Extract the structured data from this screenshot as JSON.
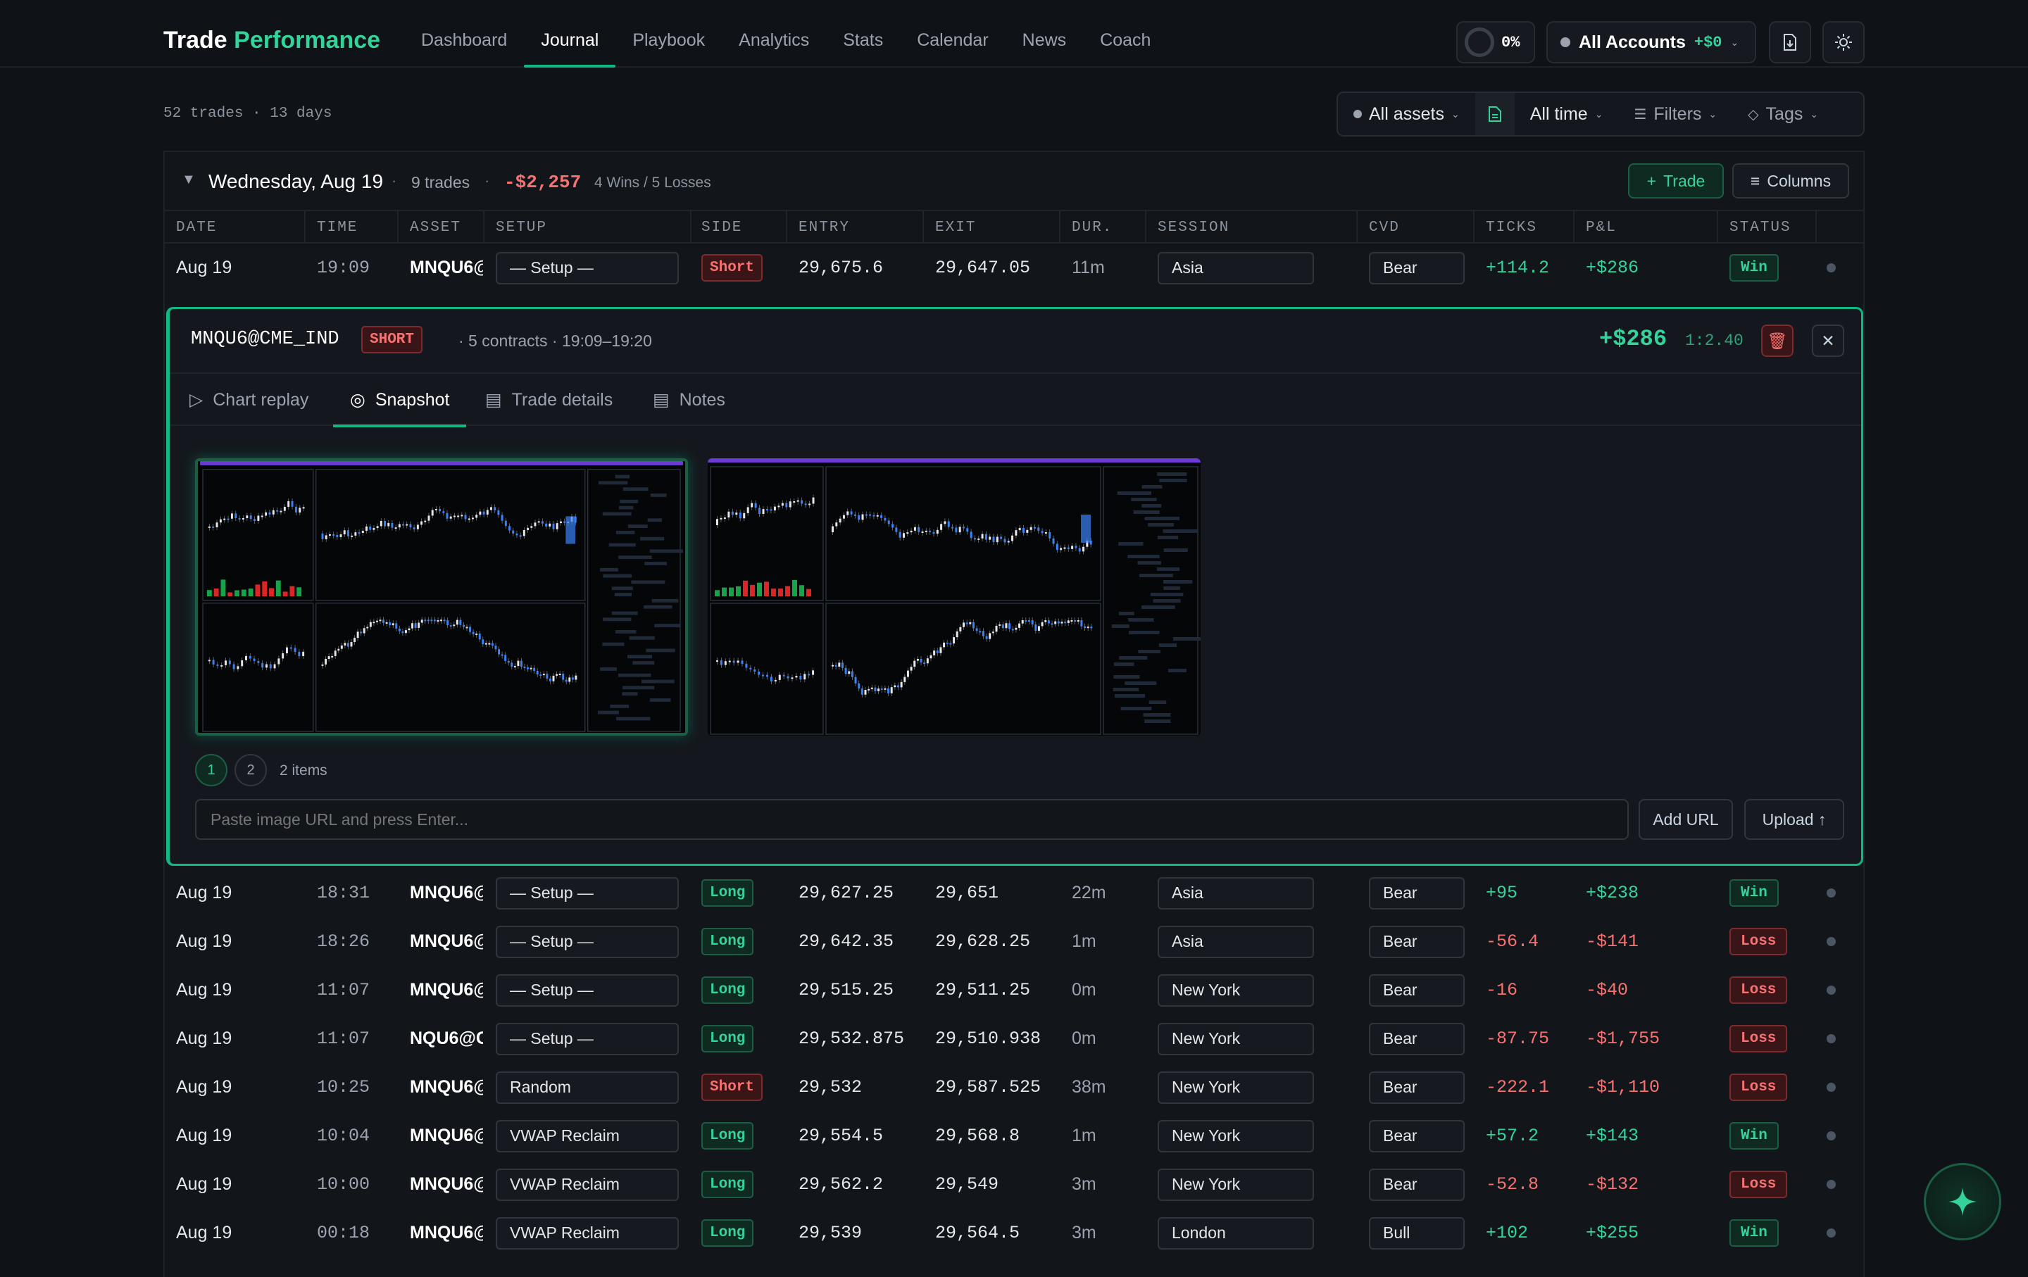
{
  "brand": {
    "title_a": "Trade",
    "title_b": "Performance"
  },
  "nav": [
    "Dashboard",
    "Journal",
    "Playbook",
    "Analytics",
    "Stats",
    "Calendar",
    "News",
    "Coach"
  ],
  "header": {
    "progress": "0%",
    "accounts_label": "All Accounts",
    "accounts_value": "+$0"
  },
  "meta": {
    "count": "52 trades · 13 days"
  },
  "filters": {
    "assets": "All assets",
    "time": "All time",
    "filters": "Filters",
    "tags": "Tags"
  },
  "day": {
    "title": "Wednesday, Aug 19",
    "trades": "9 trades",
    "pnl": "-$2,257",
    "record": "4 Wins / 5 Losses",
    "add_trade": "Trade",
    "columns": "Columns"
  },
  "columns": [
    "DATE",
    "TIME",
    "ASSET",
    "SETUP",
    "SIDE",
    "ENTRY",
    "EXIT",
    "DUR.",
    "SESSION",
    "CVD",
    "TICKS",
    "P&L",
    "STATUS"
  ],
  "panel": {
    "symbol": "MNQU6@CME_IND",
    "side": "SHORT",
    "summary": "· 5 contracts · 19:09–19:20",
    "pnl": "+$286",
    "rr": "1:2.40",
    "tabs": [
      "Chart replay",
      "Snapshot",
      "Trade details",
      "Notes"
    ],
    "pages": [
      "1",
      "2"
    ],
    "items": "2 items",
    "url_placeholder": "Paste image URL and press Enter...",
    "add_url": "Add URL",
    "upload": "Upload ↑"
  },
  "rows": [
    {
      "date": "Aug 19",
      "time": "19:09",
      "asset": "MNQU6@",
      "setup": "— Setup —",
      "side": "Short",
      "entry": "29,675.6",
      "exit": "29,647.05",
      "dur": "11m",
      "session": "Asia",
      "cvd": "Bear",
      "ticks": "+114.2",
      "pnl": "+$286",
      "status": "Win"
    },
    {
      "date": "Aug 19",
      "time": "18:31",
      "asset": "MNQU6@",
      "setup": "— Setup —",
      "side": "Long",
      "entry": "29,627.25",
      "exit": "29,651",
      "dur": "22m",
      "session": "Asia",
      "cvd": "Bear",
      "ticks": "+95",
      "pnl": "+$238",
      "status": "Win"
    },
    {
      "date": "Aug 19",
      "time": "18:26",
      "asset": "MNQU6@",
      "setup": "— Setup —",
      "side": "Long",
      "entry": "29,642.35",
      "exit": "29,628.25",
      "dur": "1m",
      "session": "Asia",
      "cvd": "Bear",
      "ticks": "-56.4",
      "pnl": "-$141",
      "status": "Loss"
    },
    {
      "date": "Aug 19",
      "time": "11:07",
      "asset": "MNQU6@",
      "setup": "— Setup —",
      "side": "Long",
      "entry": "29,515.25",
      "exit": "29,511.25",
      "dur": "0m",
      "session": "New York",
      "cvd": "Bear",
      "ticks": "-16",
      "pnl": "-$40",
      "status": "Loss"
    },
    {
      "date": "Aug 19",
      "time": "11:07",
      "asset": "NQU6@C",
      "setup": "— Setup —",
      "side": "Long",
      "entry": "29,532.875",
      "exit": "29,510.938",
      "dur": "0m",
      "session": "New York",
      "cvd": "Bear",
      "ticks": "-87.75",
      "pnl": "-$1,755",
      "status": "Loss"
    },
    {
      "date": "Aug 19",
      "time": "10:25",
      "asset": "MNQU6@",
      "setup": "Random",
      "side": "Short",
      "entry": "29,532",
      "exit": "29,587.525",
      "dur": "38m",
      "session": "New York",
      "cvd": "Bear",
      "ticks": "-222.1",
      "pnl": "-$1,110",
      "status": "Loss"
    },
    {
      "date": "Aug 19",
      "time": "10:04",
      "asset": "MNQU6@",
      "setup": "VWAP Reclaim",
      "side": "Long",
      "entry": "29,554.5",
      "exit": "29,568.8",
      "dur": "1m",
      "session": "New York",
      "cvd": "Bear",
      "ticks": "+57.2",
      "pnl": "+$143",
      "status": "Win"
    },
    {
      "date": "Aug 19",
      "time": "10:00",
      "asset": "MNQU6@",
      "setup": "VWAP Reclaim",
      "side": "Long",
      "entry": "29,562.2",
      "exit": "29,549",
      "dur": "3m",
      "session": "New York",
      "cvd": "Bear",
      "ticks": "-52.8",
      "pnl": "-$132",
      "status": "Loss"
    },
    {
      "date": "Aug 19",
      "time": "00:18",
      "asset": "MNQU6@",
      "setup": "VWAP Reclaim",
      "side": "Long",
      "entry": "29,539",
      "exit": "29,564.5",
      "dur": "3m",
      "session": "London",
      "cvd": "Bull",
      "ticks": "+102",
      "pnl": "+$255",
      "status": "Win"
    }
  ],
  "colors": {
    "accent": "#10b981",
    "positive": "#34d399",
    "negative": "#f87171",
    "background": "#0f1217"
  }
}
